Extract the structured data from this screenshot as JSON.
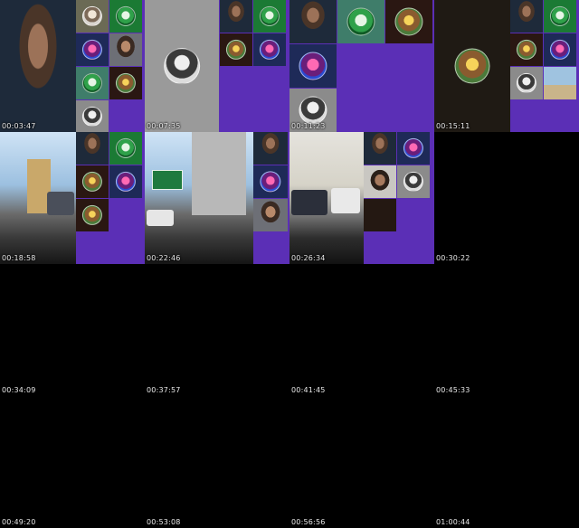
{
  "sheet": {
    "timestamps": [
      "00:03:47",
      "00:07:35",
      "00:11:23",
      "00:15:11",
      "00:18:58",
      "00:22:46",
      "00:26:34",
      "00:30:22",
      "00:34:09",
      "00:37:57",
      "00:41:45",
      "00:45:33",
      "00:49:20",
      "00:53:08",
      "00:56:56",
      "01:00:44"
    ]
  },
  "colors": {
    "background": "#000000",
    "call_background": "#5b2fb6",
    "timestamp_text": "#e8e8e8"
  },
  "icons": {
    "avatar": "profile-avatar-icon"
  }
}
